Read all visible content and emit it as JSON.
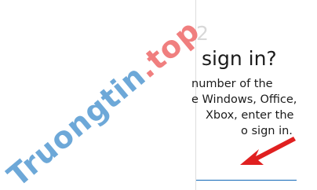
{
  "dialog": {
    "heading_fragment": "2",
    "title": "sign in?",
    "body_lines": [
      "number of the",
      "e Windows, Office,",
      "Xbox, enter the",
      "o sign in."
    ]
  },
  "watermark": {
    "part1": "Truongtin",
    "part2": ".top"
  },
  "colors": {
    "underline_accent": "#0f67b6",
    "arrow": "#e02020"
  },
  "icons": {
    "arrow": "red-arrow-icon"
  }
}
